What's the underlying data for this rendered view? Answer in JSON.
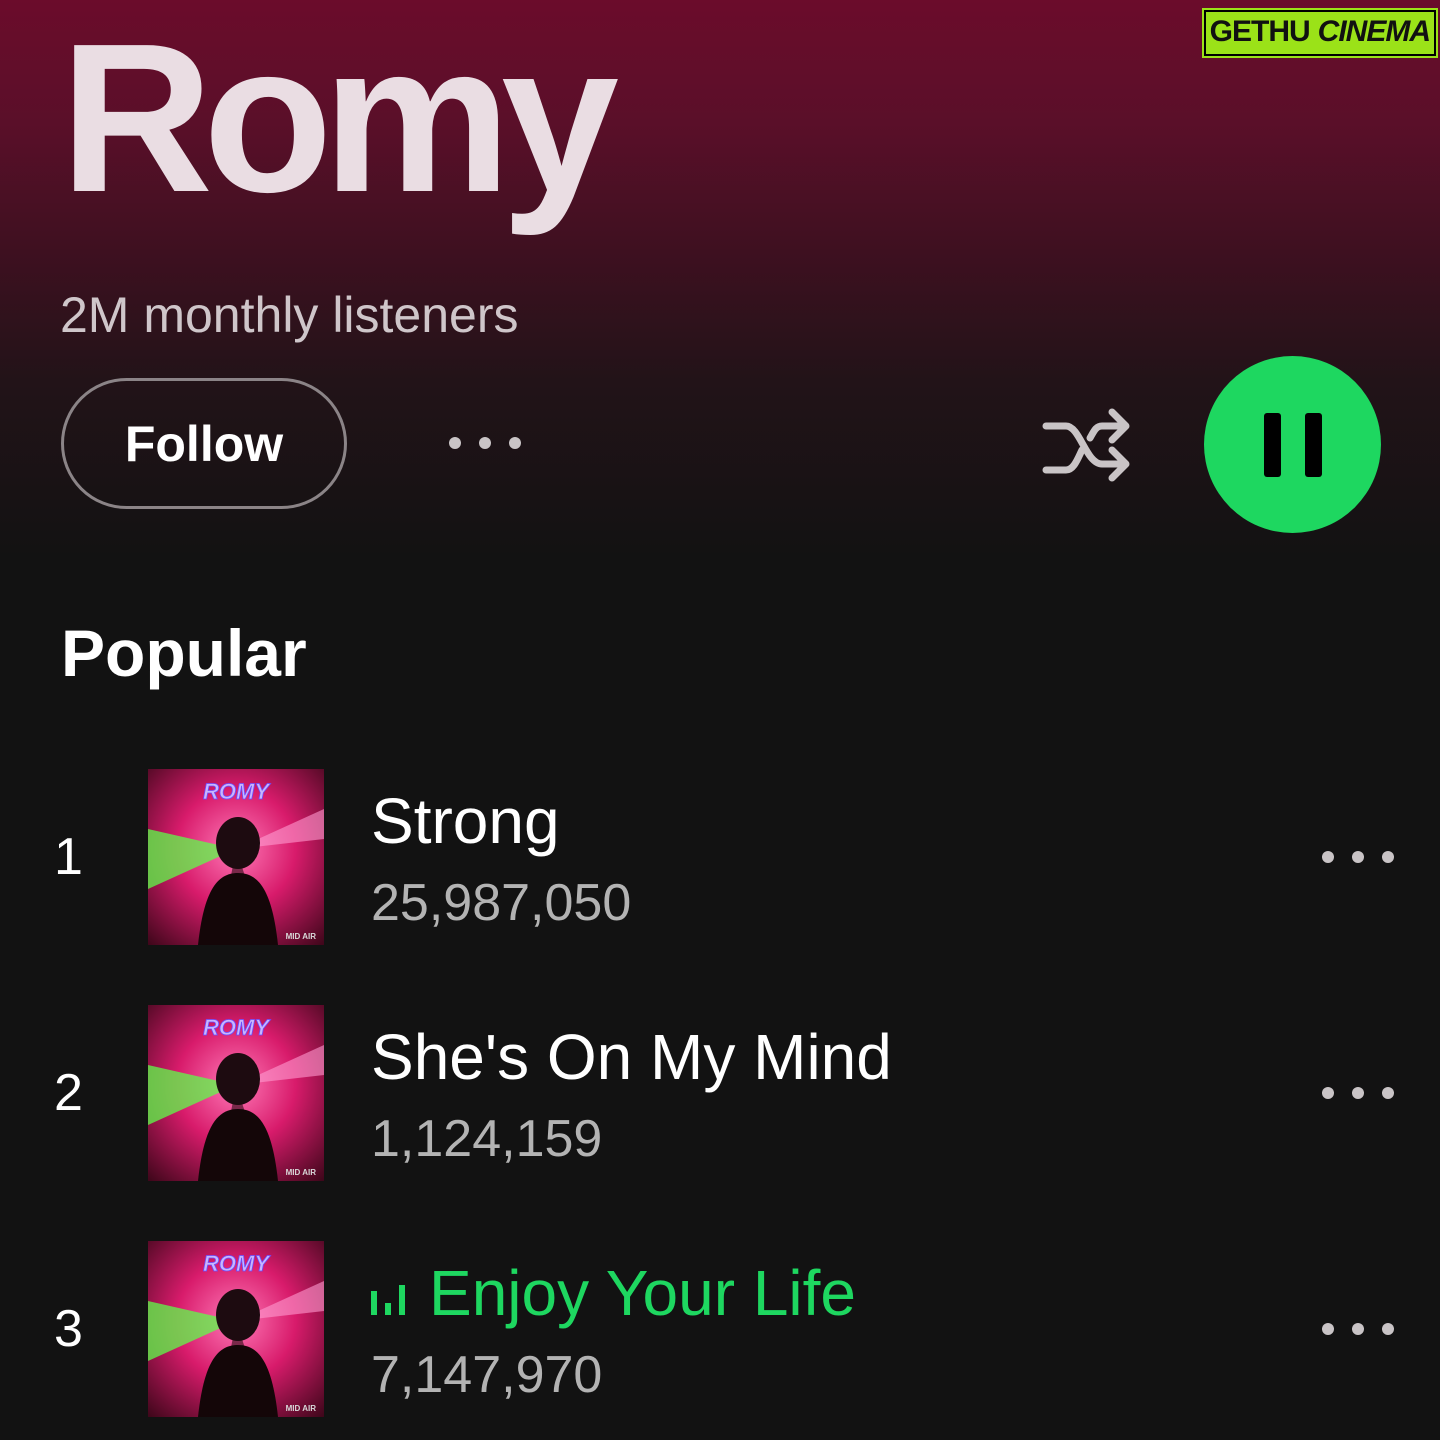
{
  "watermark": {
    "left": "GETHU",
    "right": "CINEMA"
  },
  "artist": {
    "name": "Romy",
    "monthly_listeners": "2M monthly listeners"
  },
  "actions": {
    "follow_label": "Follow"
  },
  "colors": {
    "accent": "#1ed760",
    "header_gradient_top": "#6b0c2b",
    "background": "#121212"
  },
  "popular": {
    "title": "Popular",
    "tracks": [
      {
        "rank": "1",
        "title": "Strong",
        "plays": "25,987,050",
        "playing": false,
        "cover_text": "ROMY",
        "cover_caption": "MID AIR"
      },
      {
        "rank": "2",
        "title": "She's On My Mind",
        "plays": "1,124,159",
        "playing": false,
        "cover_text": "ROMY",
        "cover_caption": "MID AIR"
      },
      {
        "rank": "3",
        "title": "Enjoy Your Life",
        "plays": "7,147,970",
        "playing": true,
        "cover_text": "ROMY",
        "cover_caption": "MID AIR"
      }
    ]
  }
}
